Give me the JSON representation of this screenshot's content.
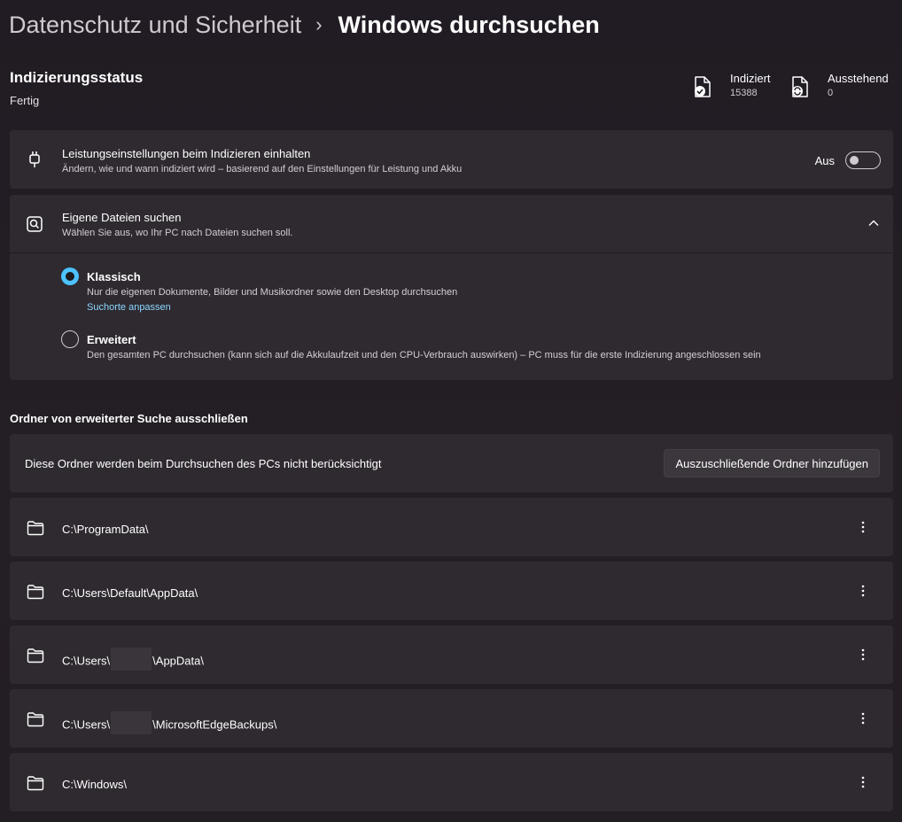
{
  "breadcrumb": {
    "parent": "Datenschutz und Sicherheit",
    "current": "Windows durchsuchen"
  },
  "indexing": {
    "title": "Indizierungsstatus",
    "status": "Fertig",
    "indexed_label": "Indiziert",
    "indexed_value": "15388",
    "pending_label": "Ausstehend",
    "pending_value": "0"
  },
  "performance": {
    "icon": "power-plug-icon",
    "title": "Leistungseinstellungen beim Indizieren einhalten",
    "description": "Ändern, wie und wann indiziert wird – basierend auf den Einstellungen für Leistung und Akku",
    "toggle_label": "Aus",
    "toggle_on": false
  },
  "find_files": {
    "icon": "search-file-icon",
    "title": "Eigene Dateien suchen",
    "description": "Wählen Sie aus, wo Ihr PC nach Dateien suchen soll.",
    "expanded": true,
    "options": [
      {
        "title": "Klassisch",
        "description": "Nur die eigenen Dokumente, Bilder und Musikordner sowie den Desktop durchsuchen",
        "link": "Suchorte anpassen",
        "selected": true
      },
      {
        "title": "Erweitert",
        "description": "Den gesamten PC durchsuchen (kann sich auf die Akkulaufzeit und den CPU-Verbrauch auswirken) – PC muss für die erste Indizierung angeschlossen sein",
        "selected": false
      }
    ]
  },
  "exclude": {
    "section_title": "Ordner von erweiterter Suche ausschließen",
    "info": "Diese Ordner werden beim Durchsuchen des PCs nicht berücksichtigt",
    "add_button": "Auszuschließende Ordner hinzufügen",
    "folders": [
      {
        "parts": [
          "C:\\ProgramData\\"
        ]
      },
      {
        "parts": [
          "C:\\Users\\Default\\AppData\\"
        ]
      },
      {
        "parts": [
          "C:\\Users\\",
          "\\AppData\\"
        ]
      },
      {
        "parts": [
          "C:\\Users\\",
          "\\MicrosoftEdgeBackups\\"
        ]
      },
      {
        "parts": [
          "C:\\Windows\\"
        ]
      }
    ]
  },
  "colors": {
    "accent": "#4cc2ff",
    "link": "#8ad7ff",
    "card": "#2f2a30",
    "background": "#221d24"
  }
}
